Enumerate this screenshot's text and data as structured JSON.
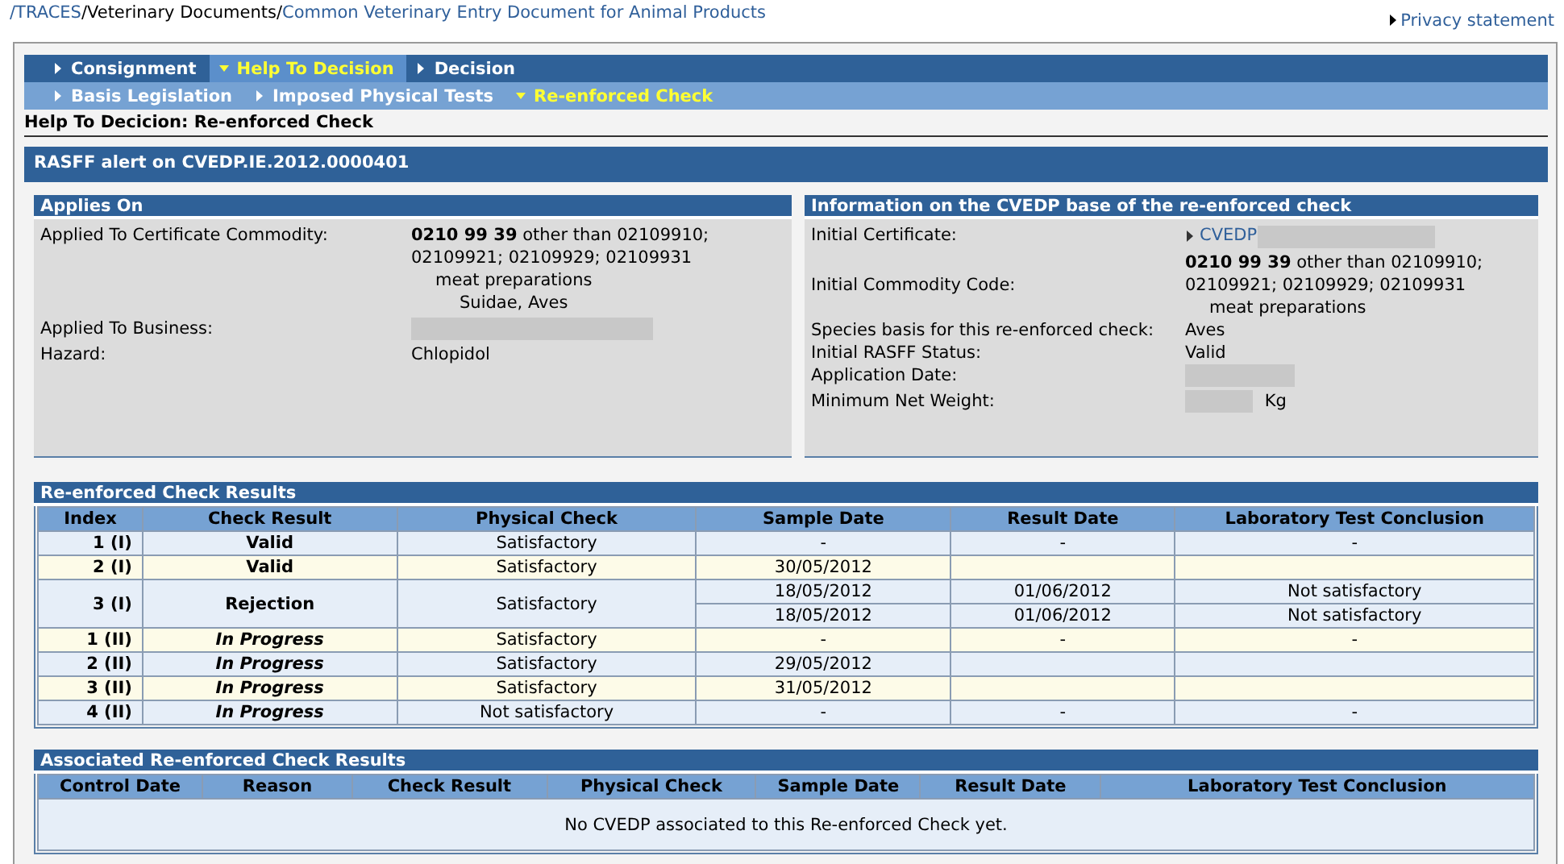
{
  "breadcrumb": [
    {
      "label": "/TRACES",
      "kind": "link"
    },
    {
      "label": "/Veterinary Documents/",
      "kind": "text"
    },
    {
      "label": "Common Veterinary Entry Document for Animal Products",
      "kind": "link"
    }
  ],
  "privacy_link": "Privacy statement",
  "menu": [
    {
      "label": "Consignment",
      "selected": false
    },
    {
      "label": "Help To Decision",
      "selected": true
    },
    {
      "label": "Decision",
      "selected": false
    }
  ],
  "submenu": [
    {
      "label": "Basis Legislation",
      "selected": false
    },
    {
      "label": "Imposed Physical Tests",
      "selected": false
    },
    {
      "label": "Re-enforced Check",
      "selected": true
    }
  ],
  "page_title": "Help To Decicion: Re-enforced Check",
  "panel_title": "RASFF alert on CVEDP.IE.2012.0000401",
  "applies_on": {
    "title": "Applies On",
    "fields": [
      {
        "label": "Applied To Certificate Commodity:",
        "lines": [
          {
            "text": "**0210 99 39** other than 02109910;",
            "kind": "code"
          },
          {
            "text": "02109921; 02109929; 02109931",
            "kind": "code"
          },
          {
            "text": "meat preparations",
            "kind": "description"
          },
          {
            "text": "Suidae, Aves",
            "kind": "species"
          }
        ]
      },
      {
        "label": "Applied To Business:",
        "redacted": true
      },
      {
        "label": "Hazard:",
        "lines": [
          {
            "text": "Chlopidol",
            "kind": "code"
          }
        ]
      }
    ]
  },
  "initial_info": {
    "title": "Information on the CVEDP base of the re-enforced check",
    "fields": [
      {
        "label": "Initial Certificate:",
        "link": "CVEDP",
        "redacted": true
      },
      {
        "label": "Initial Commodity Code:",
        "lines": [
          {
            "text": "**0210 99 39** other than 02109910;",
            "kind": "code"
          },
          {
            "text": "02109921; 02109929; 02109931",
            "kind": "code"
          },
          {
            "text": "meat preparations",
            "kind": "description"
          }
        ]
      },
      {
        "label": "Species basis for this re-enforced check:",
        "lines": [
          {
            "text": "Aves",
            "kind": "code"
          }
        ]
      },
      {
        "label": "Initial RASFF Status:",
        "lines": [
          {
            "text": "Valid",
            "kind": "code"
          }
        ]
      },
      {
        "label": "Application Date:",
        "redacted": true
      },
      {
        "label": "Minimum Net Weight:",
        "redacted": true,
        "unit": "Kg"
      }
    ]
  },
  "results": {
    "title": "Re-enforced Check Results",
    "columns": [
      "Index",
      "Check Result",
      "Physical Check",
      "Sample Date",
      "Result Date",
      "Laboratory Test Conclusion"
    ],
    "rows": [
      {
        "index": "1 (I)",
        "check_result": "Valid",
        "in_progress": false,
        "physical_check": "Satisfactory",
        "tests": [
          {
            "sample_date": "-",
            "result_date": "-",
            "conclusion": "-"
          }
        ]
      },
      {
        "index": "2 (I)",
        "check_result": "Valid",
        "in_progress": false,
        "physical_check": "Satisfactory",
        "tests": [
          {
            "sample_date": "30/05/2012"
          }
        ]
      },
      {
        "index": "3 (I)",
        "check_result": "Rejection",
        "in_progress": false,
        "physical_check": "Satisfactory",
        "tests": [
          {
            "sample_date": "18/05/2012",
            "result_date": "01/06/2012",
            "conclusion": "Not satisfactory"
          },
          {
            "sample_date": "18/05/2012",
            "result_date": "01/06/2012",
            "conclusion": "Not satisfactory"
          }
        ]
      },
      {
        "index": "1 (II)",
        "check_result": "In Progress",
        "in_progress": true,
        "physical_check": "Satisfactory",
        "tests": [
          {
            "sample_date": "-",
            "result_date": "-",
            "conclusion": "-"
          }
        ]
      },
      {
        "index": "2 (II)",
        "check_result": "In Progress",
        "in_progress": true,
        "physical_check": "Satisfactory",
        "tests": [
          {
            "sample_date": "29/05/2012"
          }
        ]
      },
      {
        "index": "3 (II)",
        "check_result": "In Progress",
        "in_progress": true,
        "physical_check": "Satisfactory",
        "tests": [
          {
            "sample_date": "31/05/2012"
          }
        ]
      },
      {
        "index": "4 (II)",
        "check_result": "In Progress",
        "in_progress": true,
        "physical_check": "Not satisfactory",
        "tests": [
          {
            "sample_date": "-",
            "result_date": "-",
            "conclusion": "-"
          }
        ]
      }
    ]
  },
  "associated": {
    "title": "Associated Re-enforced Check Results",
    "columns": [
      "Control Date",
      "Reason",
      "Check Result",
      "Physical Check",
      "Sample Date",
      "Result Date",
      "Laboratory Test Conclusion"
    ],
    "empty_message": "No CVEDP associated to this Re-enforced Check yet."
  }
}
